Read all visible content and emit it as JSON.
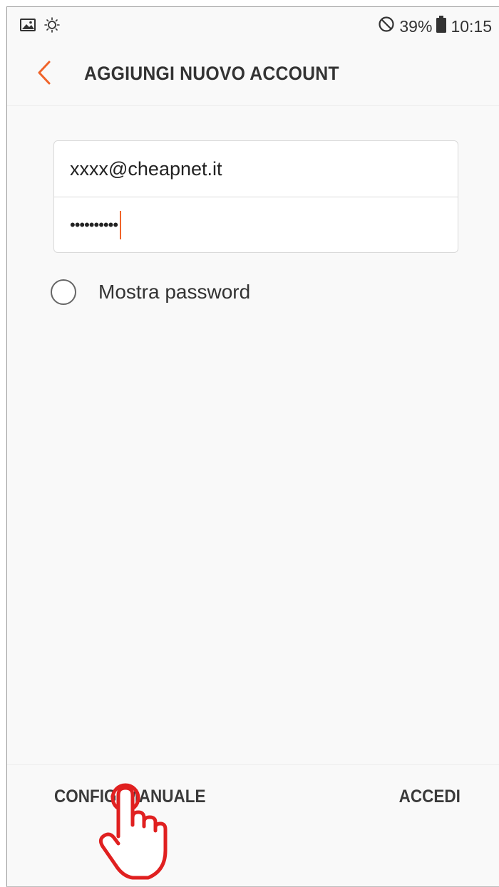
{
  "status_bar": {
    "battery": "39%",
    "time": "10:15",
    "icons": [
      "gallery-icon",
      "brightness-icon",
      "do-not-disturb-icon",
      "battery-icon"
    ]
  },
  "header": {
    "title": "AGGIUNGI NUOVO ACCOUNT",
    "back_icon": "chevron-left-icon"
  },
  "form": {
    "email_value": "xxxx@cheapnet.it",
    "password_mask": "••••••••••",
    "show_password_label": "Mostra password",
    "show_password_checked": false
  },
  "footer": {
    "manual_config_label": "CONFIG. MANUALE",
    "login_label": "ACCEDI"
  },
  "colors": {
    "accent": "#f0642a",
    "hand": "#e02020",
    "background": "#f9f9f9",
    "text": "#333333"
  }
}
